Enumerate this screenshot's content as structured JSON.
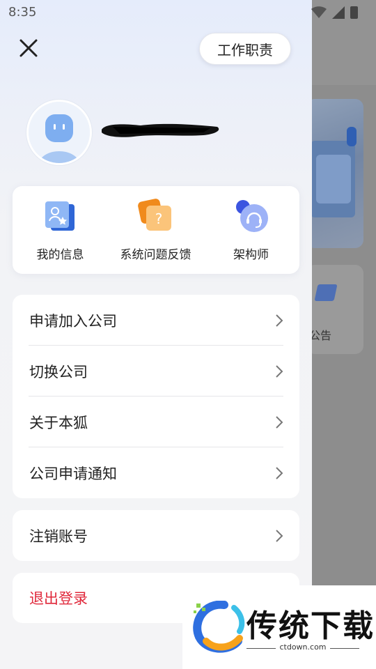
{
  "status_bar": {
    "time": "8:35"
  },
  "header": {
    "duty_button_label": "工作职责"
  },
  "quick_actions": [
    {
      "label": "我的信息",
      "icon": "profile-card-icon"
    },
    {
      "label": "系统问题反馈",
      "icon": "feedback-question-icon"
    },
    {
      "label": "架构师",
      "icon": "headset-support-icon"
    }
  ],
  "menu_group_1": [
    {
      "label": "申请加入公司"
    },
    {
      "label": "切换公司"
    },
    {
      "label": "关于本狐"
    },
    {
      "label": "公司申请通知"
    }
  ],
  "menu_group_2": [
    {
      "label": "注销账号"
    }
  ],
  "logout": {
    "label": "退出登录",
    "color": "#e0283b"
  },
  "background_app": {
    "visible_label": "公告"
  },
  "watermark": {
    "title": "传统下载",
    "url": "ctdown.com"
  },
  "colors": {
    "accent_blue": "#3f7be8",
    "danger": "#e0283b",
    "drawer_bg": "#f4f4f6"
  }
}
